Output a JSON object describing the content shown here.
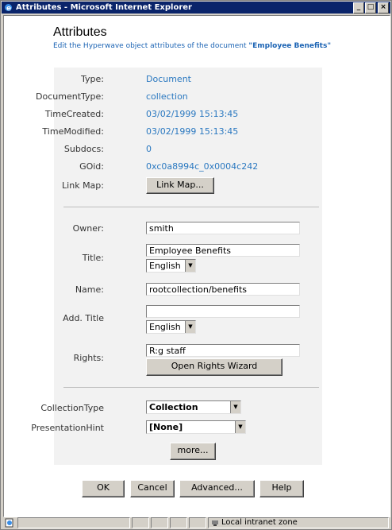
{
  "window": {
    "title": "Attributes - Microsoft Internet Explorer"
  },
  "page": {
    "title": "Attributes",
    "subtitle_prefix": "Edit the Hyperwave object attributes of the document ",
    "subtitle_doc": "\"Employee Benefits\""
  },
  "info": {
    "type_label": "Type:",
    "type_value": "Document",
    "doctype_label": "DocumentType:",
    "doctype_value": "collection",
    "created_label": "TimeCreated:",
    "created_value": "03/02/1999 15:13:45",
    "modified_label": "TimeModified:",
    "modified_value": "03/02/1999 15:13:45",
    "subdocs_label": "Subdocs:",
    "subdocs_value": "0",
    "goid_label": "GOid:",
    "goid_value": "0xc0a8994c_0x0004c242",
    "linkmap_label": "Link Map:",
    "linkmap_button": "Link Map..."
  },
  "form": {
    "owner_label": "Owner:",
    "owner_value": "smith",
    "title_label": "Title:",
    "title_value": "Employee Benefits",
    "title_lang": "English",
    "name_label": "Name:",
    "name_value": "rootcollection/benefits",
    "addtitle_label": "Add. Title",
    "addtitle_value": "",
    "addtitle_lang": "English",
    "rights_label": "Rights:",
    "rights_value": "R:g staff",
    "rights_button": "Open Rights Wizard",
    "collectiontype_label": "CollectionType",
    "collectiontype_value": "Collection",
    "presentationhint_label": "PresentationHint",
    "presentationhint_value": "[None]",
    "more_button": "more..."
  },
  "buttons": {
    "ok": "OK",
    "cancel": "Cancel",
    "advanced": "Advanced...",
    "help": "Help"
  },
  "statusbar": {
    "zone": "Local intranet zone"
  }
}
